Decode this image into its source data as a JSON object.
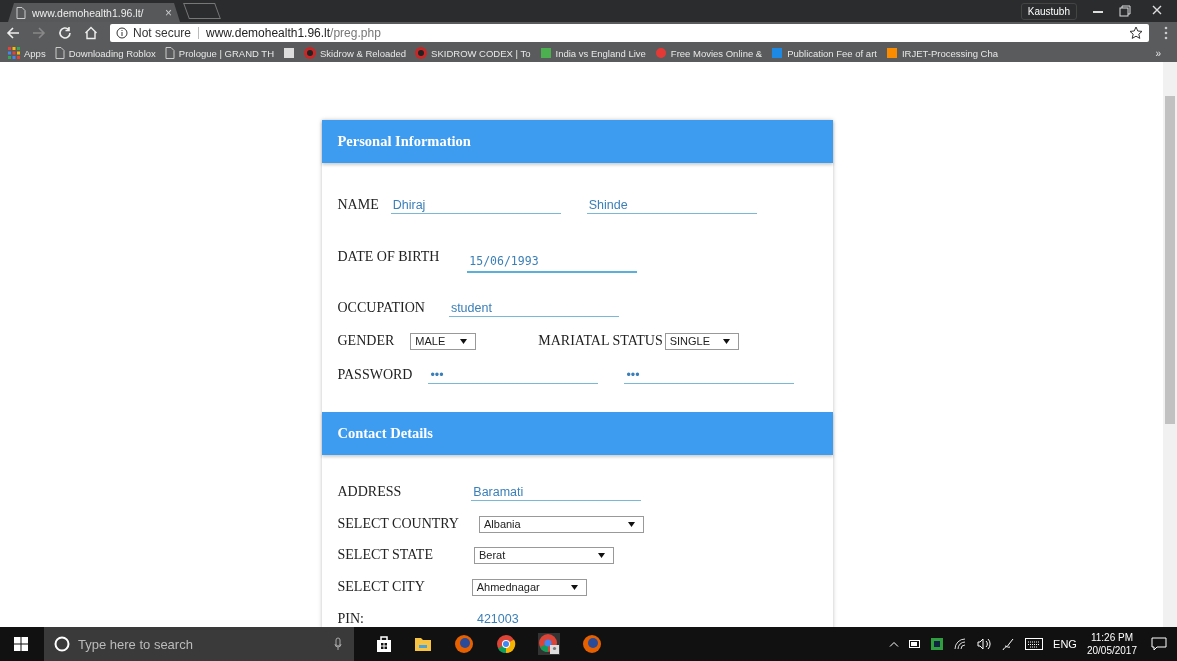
{
  "browser": {
    "tab": {
      "title": "www.demohealth1.96.lt/",
      "close": "×"
    },
    "profile": "Kaustubh",
    "security": "Not secure",
    "url_host": "www.demohealth1.96.lt",
    "url_path": "/preg.php",
    "bookmarks": [
      {
        "kind": "apps",
        "label": "Apps"
      },
      {
        "kind": "page",
        "label": "Downloading Roblox"
      },
      {
        "kind": "page",
        "label": "Prologue | GRAND TH"
      },
      {
        "kind": "dark"
      },
      {
        "kind": "skull",
        "label": "Skidrow & Reloaded"
      },
      {
        "kind": "skull",
        "label": "SKIDROW CODEX | To"
      },
      {
        "kind": "green",
        "label": "India vs England Live"
      },
      {
        "kind": "red",
        "label": "Free Movies Online &"
      },
      {
        "kind": "blue",
        "label": "Publication Fee of art"
      },
      {
        "kind": "orange",
        "label": "IRJET-Processing Cha"
      }
    ],
    "more": "»"
  },
  "sections": [
    {
      "title": "Personal Information",
      "rows": [
        [
          {
            "kind": "label",
            "text": "NAME"
          },
          {
            "kind": "input",
            "value": "Dhiraj"
          },
          {
            "kind": "input",
            "value": "Shinde"
          }
        ],
        [
          {
            "kind": "label",
            "text": "DATE OF BIRTH"
          },
          {
            "kind": "date",
            "value": "15/06/1993"
          }
        ],
        [
          {
            "kind": "label",
            "text": "OCCUPATION"
          },
          {
            "kind": "input",
            "value": "student"
          }
        ],
        [
          {
            "kind": "label",
            "text": "GENDER"
          },
          {
            "kind": "select",
            "value": "MALE"
          },
          {
            "kind": "label",
            "text": "MARIATAL STATUS"
          },
          {
            "kind": "select",
            "value": "SINGLE"
          }
        ],
        [
          {
            "kind": "label",
            "text": "PASSWORD"
          },
          {
            "kind": "input",
            "value": "•••"
          },
          {
            "kind": "input",
            "value": "•••"
          }
        ]
      ]
    },
    {
      "title": "Contact Details",
      "rows": [
        [
          {
            "kind": "label",
            "text": "ADDRESS"
          },
          {
            "kind": "input",
            "value": "Baramati"
          }
        ],
        [
          {
            "kind": "label",
            "text": "SELECT COUNTRY"
          },
          {
            "kind": "select",
            "value": "Albania"
          }
        ],
        [
          {
            "kind": "label",
            "text": "SELECT STATE"
          },
          {
            "kind": "select",
            "value": "Berat"
          }
        ],
        [
          {
            "kind": "label",
            "text": "SELECT CITY"
          },
          {
            "kind": "select",
            "value": "Ahmednagar"
          }
        ],
        [
          {
            "kind": "label",
            "text": "PIN:"
          },
          {
            "kind": "plain",
            "value": "421003"
          }
        ]
      ]
    }
  ],
  "taskbar": {
    "search_placeholder": "Type here to search",
    "language": "ENG",
    "time": "11:26 PM",
    "date": "20/05/2017"
  }
}
